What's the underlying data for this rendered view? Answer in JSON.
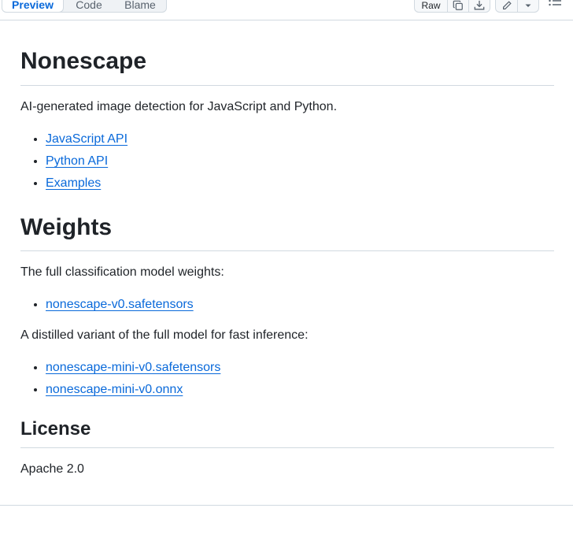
{
  "tabs": {
    "preview": "Preview",
    "code": "Code",
    "blame": "Blame"
  },
  "toolbar": {
    "raw": "Raw"
  },
  "doc": {
    "title": "Nonescape",
    "intro": "AI-generated image detection for JavaScript and Python.",
    "links": [
      "JavaScript API",
      "Python API",
      "Examples"
    ],
    "weights_heading": "Weights",
    "weights_text": "The full classification model weights:",
    "weights_links": [
      "nonescape-v0.safetensors"
    ],
    "distilled_text": "A distilled variant of the full model for fast inference:",
    "distilled_links": [
      "nonescape-mini-v0.safetensors",
      "nonescape-mini-v0.onnx"
    ],
    "license_heading": "License",
    "license_text": "Apache 2.0"
  }
}
